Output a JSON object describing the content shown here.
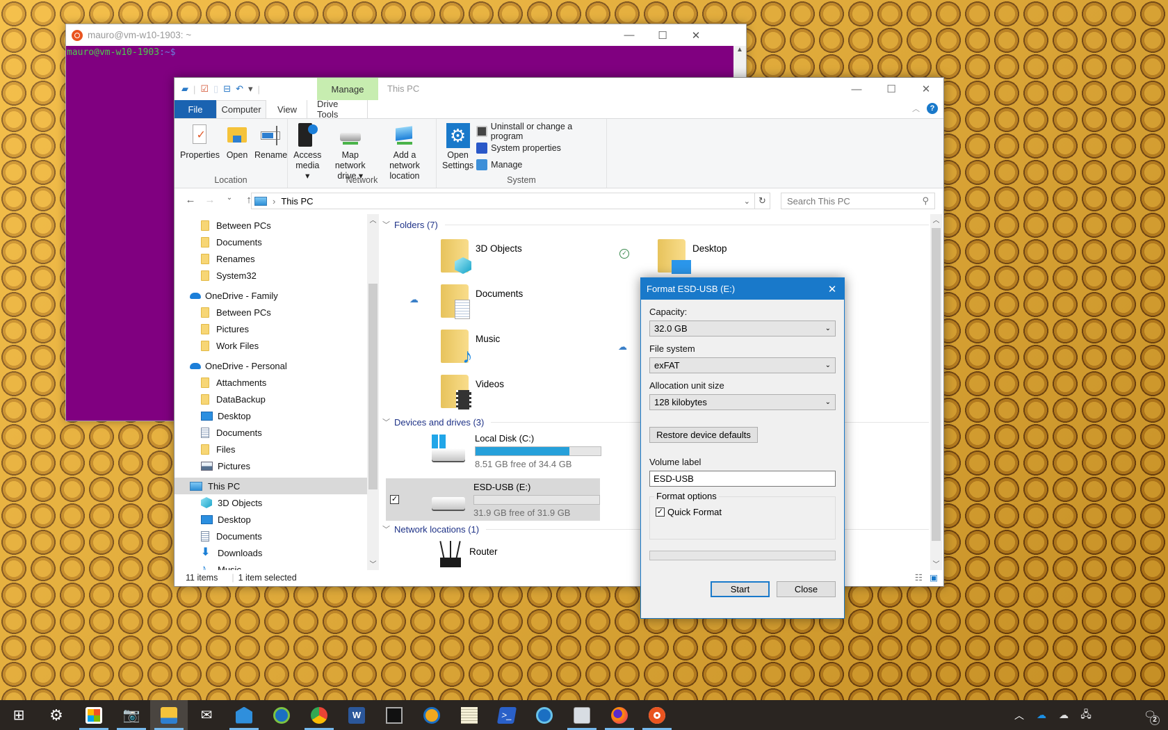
{
  "terminal": {
    "title": "mauro@vm-w10-1903: ~",
    "prompt_user": "mauro@vm-w10-1903",
    "prompt_path": ":~$"
  },
  "explorer": {
    "title": "This PC",
    "contextual_tab": "Manage",
    "tabs": [
      "File",
      "Computer",
      "View",
      "Drive Tools"
    ],
    "ribbon": {
      "location": {
        "label": "Location",
        "buttons": [
          "Properties",
          "Open",
          "Rename"
        ]
      },
      "network": {
        "label": "Network",
        "buttons": [
          {
            "line1": "Access",
            "line2": "media ▾"
          },
          {
            "line1": "Map network",
            "line2": "drive ▾"
          },
          {
            "line1": "Add a network",
            "line2": "location"
          }
        ]
      },
      "system": {
        "label": "System",
        "open_settings_1": "Open",
        "open_settings_2": "Settings",
        "items": [
          "Uninstall or change a program",
          "System properties",
          "Manage"
        ]
      }
    },
    "address": {
      "path": "This PC"
    },
    "search": {
      "placeholder": "Search This PC"
    },
    "nav_pane": [
      {
        "label": "Between PCs",
        "icon": "folder",
        "indent": 1
      },
      {
        "label": "Documents",
        "icon": "folder",
        "indent": 1
      },
      {
        "label": "Renames",
        "icon": "folder",
        "indent": 1
      },
      {
        "label": "System32",
        "icon": "folder",
        "indent": 1
      },
      {
        "label": "OneDrive - Family",
        "icon": "cloud",
        "indent": 0
      },
      {
        "label": "Between PCs",
        "icon": "folder",
        "indent": 1
      },
      {
        "label": "Pictures",
        "icon": "folder",
        "indent": 1
      },
      {
        "label": "Work Files",
        "icon": "folder",
        "indent": 1
      },
      {
        "label": "OneDrive - Personal",
        "icon": "cloud",
        "indent": 0
      },
      {
        "label": "Attachments",
        "icon": "folder",
        "indent": 1
      },
      {
        "label": "DataBackup",
        "icon": "folder",
        "indent": 1
      },
      {
        "label": "Desktop",
        "icon": "desktop",
        "indent": 1
      },
      {
        "label": "Documents",
        "icon": "doc",
        "indent": 1
      },
      {
        "label": "Files",
        "icon": "folder",
        "indent": 1
      },
      {
        "label": "Pictures",
        "icon": "pictures",
        "indent": 1
      },
      {
        "label": "This PC",
        "icon": "pc",
        "indent": 0,
        "selected": true
      },
      {
        "label": "3D Objects",
        "icon": "3d",
        "indent": 1
      },
      {
        "label": "Desktop",
        "icon": "desktop",
        "indent": 1
      },
      {
        "label": "Documents",
        "icon": "doc",
        "indent": 1
      },
      {
        "label": "Downloads",
        "icon": "download",
        "indent": 1
      },
      {
        "label": "Music",
        "icon": "music",
        "indent": 1
      }
    ],
    "sections": {
      "folders": "Folders (7)",
      "drives": "Devices and drives (3)",
      "network": "Network locations (1)"
    },
    "folders": [
      "3D Objects",
      "Desktop",
      "Documents",
      "Music",
      "Videos"
    ],
    "drives": [
      {
        "name": "Local Disk (C:)",
        "free": "8.51 GB free of 34.4 GB",
        "used_fraction": 0.75
      },
      {
        "name": "ESD-USB (E:)",
        "free": "31.9 GB free of 31.9 GB",
        "used_fraction": 0.0,
        "selected": true
      }
    ],
    "network_items": [
      "Router"
    ],
    "status": {
      "items": "11 items",
      "selected": "1 item selected"
    }
  },
  "format_dialog": {
    "title": "Format ESD-USB (E:)",
    "capacity_label": "Capacity:",
    "capacity_value": "32.0 GB",
    "fs_label": "File system",
    "fs_value": "exFAT",
    "alloc_label": "Allocation unit size",
    "alloc_value": "128 kilobytes",
    "restore_button": "Restore device defaults",
    "volume_label": "Volume label",
    "volume_value": "ESD-USB",
    "options_label": "Format options",
    "quick_format": "Quick Format",
    "quick_format_checked": true,
    "progress": 0,
    "start_button": "Start",
    "close_button": "Close"
  },
  "taskbar": {
    "apps": [
      "start",
      "settings",
      "store",
      "camera",
      "file-explorer",
      "mail",
      "app-azure",
      "edge-dev",
      "chrome",
      "word",
      "terminal",
      "edge-canary",
      "notepad",
      "powershell",
      "edge-beta",
      "perf-monitor",
      "firefox",
      "ubuntu"
    ],
    "notification_count": "2"
  }
}
